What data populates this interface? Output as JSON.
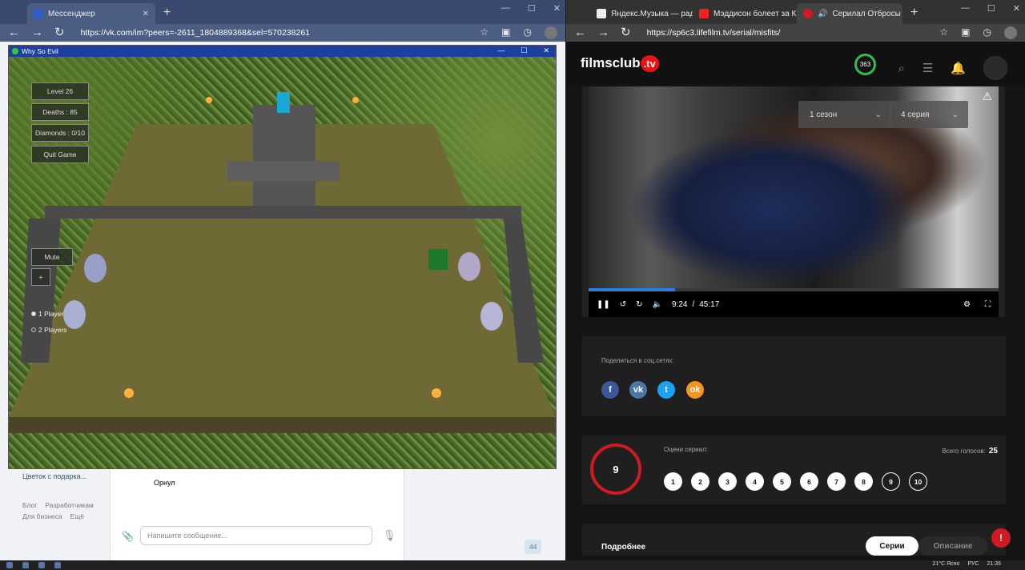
{
  "left_browser": {
    "tabs": [
      {
        "title": "Мессенджер"
      }
    ],
    "url": "https://vk.com/im?peers=-2611_1804889368&sel=570238261"
  },
  "vk": {
    "sidebar_item": "Цветок с подарка...",
    "footer_links": [
      "Блог",
      "Разработчикам",
      "Для бизнеса",
      "Ещё"
    ],
    "message_text": "Орнул",
    "input_placeholder": "Напишите сообщение...",
    "count_badge": "44"
  },
  "game": {
    "title": "Why So Evil",
    "level": "Level 26",
    "deaths": "Deaths : 85",
    "diamonds": "Diamonds : 0/10",
    "quit": "Quit Game",
    "mute": "Mute",
    "plus": "+",
    "player1": "1 Player",
    "player2": "2 Players"
  },
  "right_browser": {
    "tabs": [
      {
        "title": "Яндекс.Музыка — ради"
      },
      {
        "title": "Мэддисон болеет за Кра"
      },
      {
        "title": "Серилал Отбросы в"
      }
    ],
    "url": "https://sp6c3.lifefilm.tv/serial/misfits/"
  },
  "site": {
    "logo": "filmsclub",
    "logo_tv": ".tv",
    "score": "363",
    "season": "1 сезон",
    "episode": "4 серия",
    "time_current": "9:24",
    "time_sep": "/",
    "time_total": "45:17",
    "progress": 0.21,
    "share_label": "Поделиться в соц.сетях:",
    "socials": [
      {
        "name": "facebook",
        "glyph": "f",
        "color": "#3b5998"
      },
      {
        "name": "vk",
        "glyph": "vk",
        "color": "#4a76a8"
      },
      {
        "name": "twitter",
        "glyph": "t",
        "color": "#1da1f2"
      },
      {
        "name": "odnoklassniki",
        "glyph": "ok",
        "color": "#f7931e"
      }
    ],
    "rating": "9",
    "rate_label": "Оцени сериал:",
    "votes_label": "Всего голосов:",
    "votes": "25",
    "rating_buttons": [
      "1",
      "2",
      "3",
      "4",
      "5",
      "6",
      "7",
      "8",
      "9",
      "10"
    ],
    "details_title": "Подробнее",
    "btn_series": "Серии",
    "btn_desc": "Описание",
    "accent": "#d01a22"
  },
  "taskbar": {
    "weather": "21°C Ясно",
    "lang": "РУС",
    "time": "21:35"
  }
}
